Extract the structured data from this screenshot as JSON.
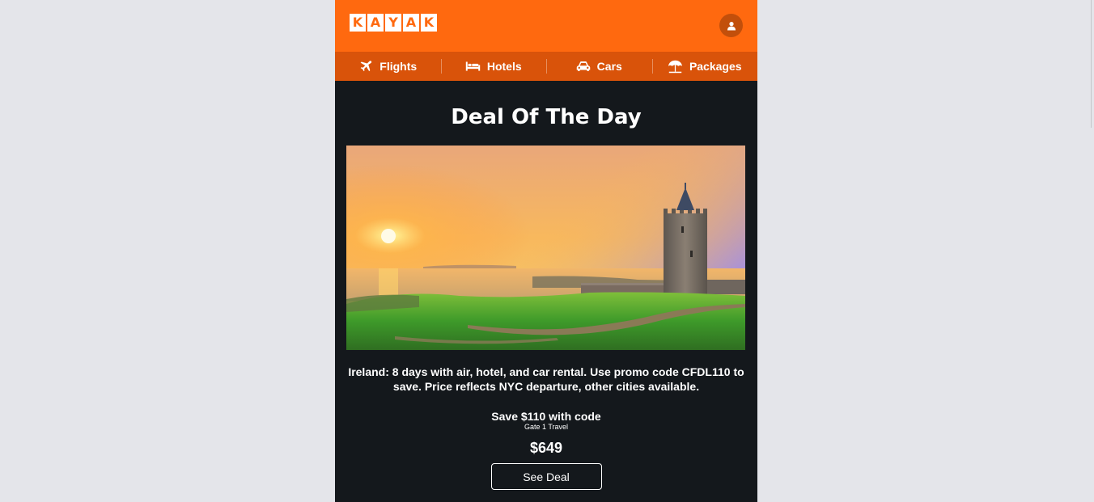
{
  "header": {
    "logo_letters": [
      "K",
      "A",
      "Y",
      "A",
      "K"
    ],
    "account_icon": "user-icon"
  },
  "nav": {
    "items": [
      {
        "label": "Flights",
        "icon": "airplane-icon"
      },
      {
        "label": "Hotels",
        "icon": "bed-icon"
      },
      {
        "label": "Cars",
        "icon": "car-icon"
      },
      {
        "label": "Packages",
        "icon": "beach-umbrella-icon"
      }
    ]
  },
  "deal": {
    "title": "Deal Of The Day",
    "description": "Ireland: 8 days with air, hotel, and car rental. Use promo code CFDL110 to save. Price reflects NYC departure, other cities available.",
    "save_text": "Save $110 with code",
    "provider": "Gate 1 Travel",
    "price": "$649",
    "button_label": "See Deal"
  },
  "colors": {
    "brand_orange": "#ff690f",
    "nav_orange": "#d9530a",
    "email_background": "#14181c",
    "page_background": "#e4e5ea"
  }
}
